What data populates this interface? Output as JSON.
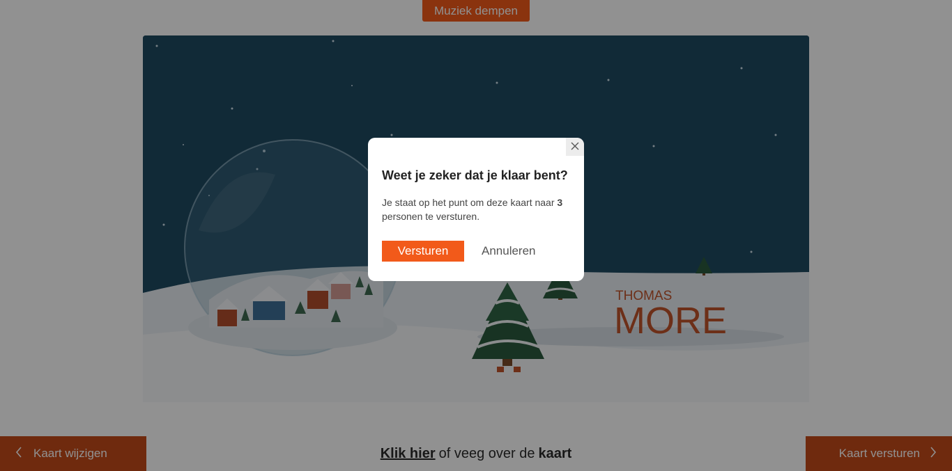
{
  "header": {
    "mute_label": "Muziek dempen"
  },
  "card": {
    "logo_line1": "THOMAS",
    "logo_line2": "MORE"
  },
  "footer": {
    "prev_label": "Kaart wijzigen",
    "next_label": "Kaart versturen",
    "link_label": "Klik hier",
    "middle_text": "of veeg over de",
    "bold_text": "kaart"
  },
  "dialog": {
    "title": "Weet je zeker dat je klaar bent?",
    "body_before": "Je staat op het punt om deze kaart naar",
    "recipient_count": "3",
    "body_after": "personen te versturen.",
    "confirm_label": "Versturen",
    "cancel_label": "Annuleren"
  },
  "icons": {
    "close": "close-icon",
    "prev": "chevron-left-icon",
    "next": "chevron-right-icon"
  },
  "colors": {
    "accent": "#f25a1a",
    "nav_button": "#c44a1a",
    "night_sky": "#1f4a62",
    "snow": "#f3f6f8",
    "logo": "#c0532b"
  }
}
